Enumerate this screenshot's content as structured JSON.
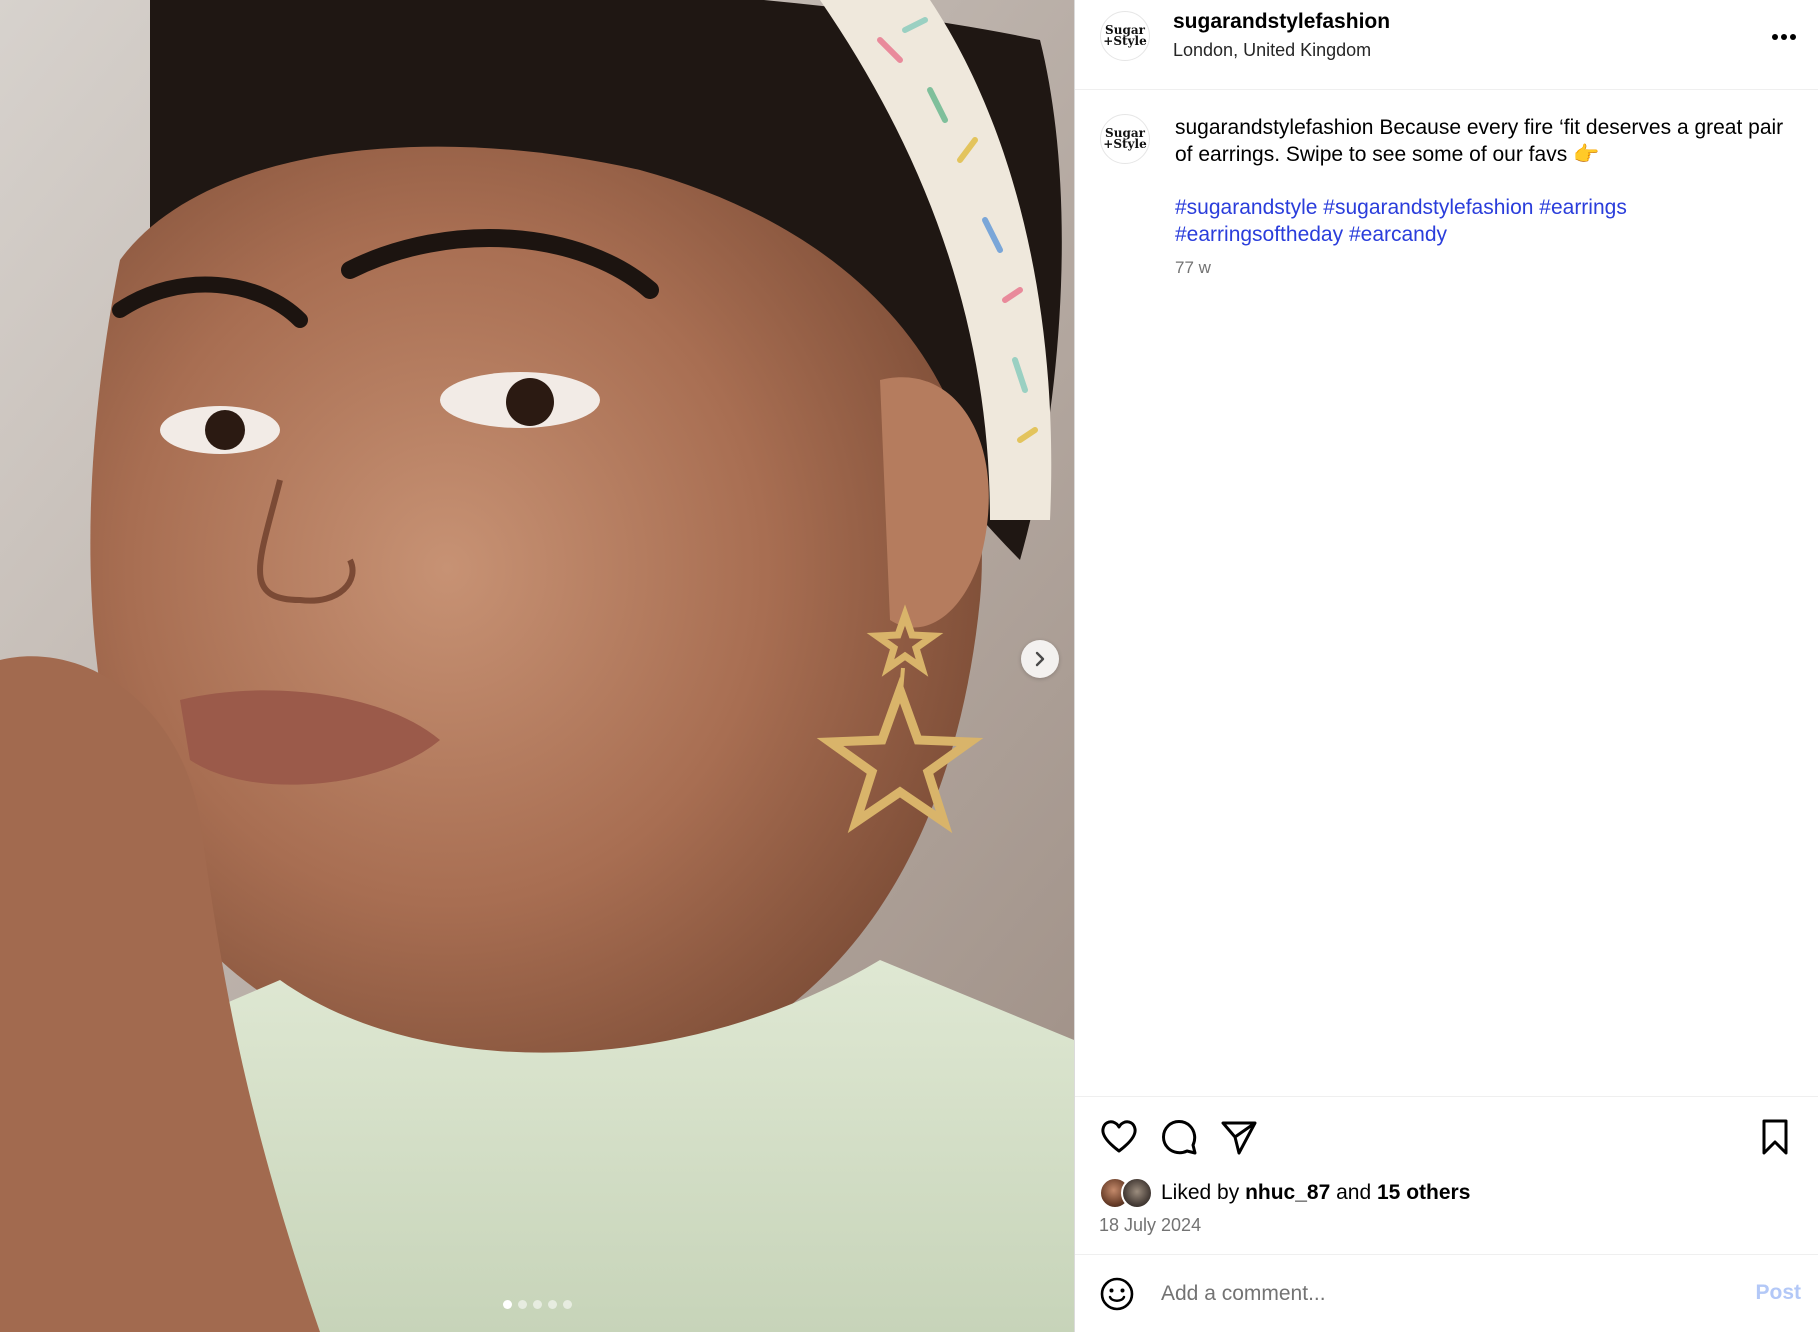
{
  "post": {
    "username": "sugarandstylefashion",
    "location": "London, United Kingdom",
    "avatar_line1": "Sugar",
    "avatar_line2": "+Style",
    "caption": "Because every fire ‘fit deserves a great pair of earrings. Swipe to see some of our favs 👉",
    "hashtags": [
      "#sugarandstyle",
      "#sugarandstylefashion",
      "#earrings",
      "#earringsoftheday",
      "#earcandy"
    ],
    "time_ago": "77 w",
    "liked_by_prefix": "Liked by",
    "liked_by_user": "nhuc_87",
    "liked_by_and": "and",
    "liked_by_others": "15 others",
    "date": "18 July 2024"
  },
  "carousel": {
    "total_slides": 5,
    "current_slide": 1
  },
  "comment": {
    "placeholder": "Add a comment...",
    "post_label": "Post"
  },
  "icons": {
    "like": "heart-icon",
    "comment": "comment-icon",
    "share": "share-icon",
    "save": "bookmark-icon",
    "more": "more-options-icon",
    "emoji": "emoji-icon",
    "next": "chevron-right-icon"
  },
  "colors": {
    "hashtag": "#2a3ddb",
    "post_button_disabled": "#b3c8f7",
    "muted_text": "#737373"
  }
}
